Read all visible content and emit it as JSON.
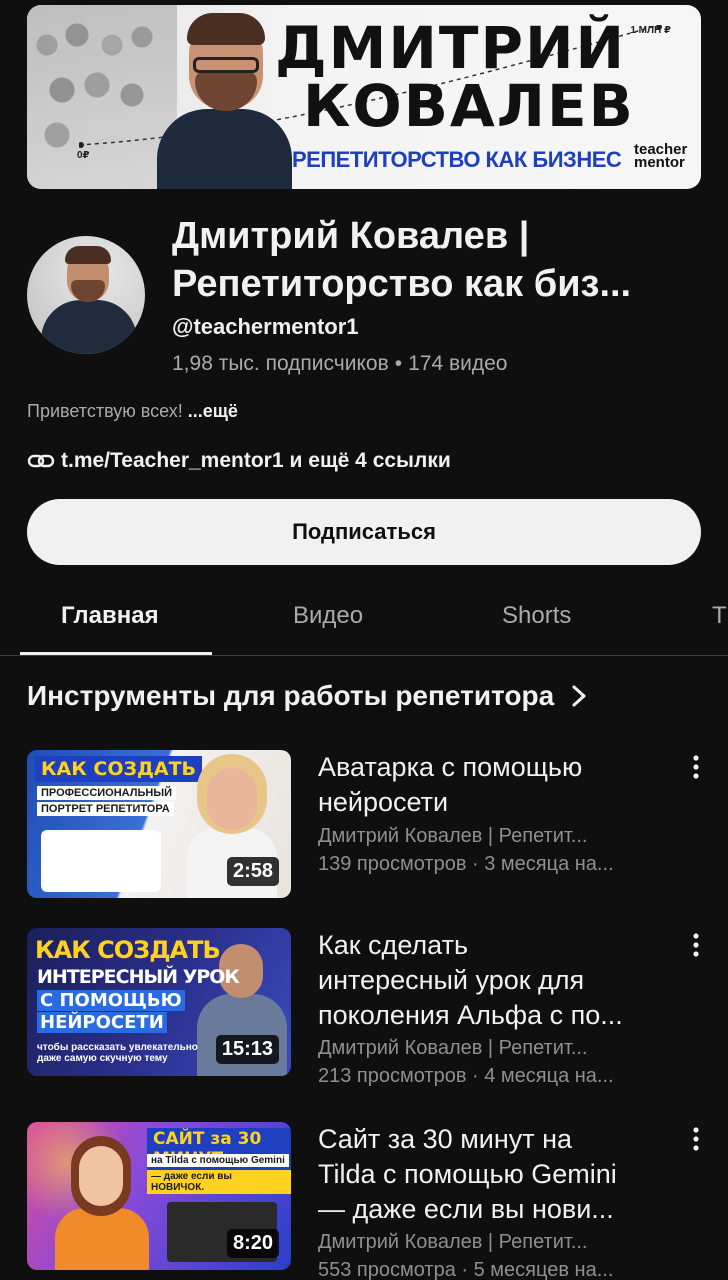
{
  "banner": {
    "name_line1": "ДМИТРИЙ",
    "name_line2": "КОВАЛЕВ",
    "tagline": "РЕПЕТИТОРСТВО КАК БИЗНЕС",
    "brand_line1": "teacher",
    "brand_line2": "mentor",
    "start_label": "0₽",
    "end_label": "1 МЛН ₽"
  },
  "channel": {
    "title_line1": "Дмитрий Ковалев |",
    "title_line2": "Репетиторство как биз...",
    "handle": "@teachermentor1",
    "subscribers": "1,98 тыс. подписчиков",
    "separator": "•",
    "videos_count": "174 видео",
    "description": "Приветствую всех!",
    "description_more": "...ещё",
    "link": "t.me/Teacher_mentor1",
    "links_more": "и ещё 4 ссылки",
    "subscribe_label": "Подписаться"
  },
  "tabs": [
    {
      "label": "Главная",
      "active": true
    },
    {
      "label": "Видео",
      "active": false
    },
    {
      "label": "Shorts",
      "active": false
    },
    {
      "label": "T",
      "active": false
    }
  ],
  "section": {
    "title": "Инструменты для работы репетитора"
  },
  "videos": [
    {
      "title_lines": [
        "Аватарка с помощью",
        "нейросети"
      ],
      "channel": "Дмитрий Ковалев | Репетит...",
      "meta": "139 просмотров · 3 месяца на...",
      "duration": "2:58",
      "thumb_text": [
        "КАК СОЗДАТЬ",
        "ПРОФЕССИОНАЛЬНЫЙ",
        "ПОРТРЕТ РЕПЕТИТОРА"
      ]
    },
    {
      "title_lines": [
        "Как сделать",
        "интересный урок для",
        "поколения Альфа с по..."
      ],
      "channel": "Дмитрий Ковалев | Репетит...",
      "meta": "213 просмотров · 4 месяца на...",
      "duration": "15:13",
      "thumb_text": [
        "КАК СОЗДАТЬ",
        "ИНТЕРЕСНЫЙ УРОК",
        "С ПОМОЩЬЮ",
        "НЕЙРОСЕТИ",
        "чтобы рассказать увлекательно даже самую скучную тему"
      ]
    },
    {
      "title_lines": [
        "Сайт за 30 минут на",
        "Tilda с помощью Gemini",
        "— даже если вы нови..."
      ],
      "channel": "Дмитрий Ковалев | Репетит...",
      "meta": "553 просмотра · 5 месяцев на...",
      "duration": "8:20",
      "thumb_text": [
        "САЙТ за 30 МИНУТ",
        "на Tilda с помощью Gemini",
        "— даже если вы НОВИЧОК."
      ]
    }
  ],
  "colors": {
    "background": "#0f0f0f",
    "text_primary": "#f1f1f1",
    "text_secondary": "#aaaaaa",
    "subscribe_bg": "#f1f1f1"
  }
}
